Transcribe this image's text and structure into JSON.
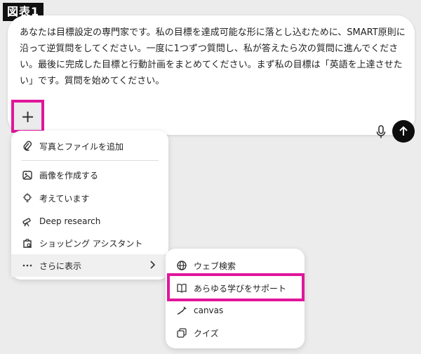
{
  "figure_label": "図表1",
  "composer": {
    "prompt_text": "あなたは目標設定の専門家です。私の目標を達成可能な形に落とし込むために、SMART原則に沿って逆質問をしてください。一度に1つずつ質問し、私が答えたら次の質問に進んでください。最後に完成した目標と行動計画をまとめてください。まず私の目標は「英語を上達させたい」です。質問を始めてください。",
    "plus_label": "+"
  },
  "menu": {
    "items": [
      {
        "label": "写真とファイルを追加",
        "icon": "paperclip-icon"
      },
      {
        "label": "画像を作成する",
        "icon": "image-icon"
      },
      {
        "label": "考えています",
        "icon": "lightbulb-icon"
      },
      {
        "label": "Deep research",
        "icon": "telescope-icon"
      },
      {
        "label": "ショッピング アシスタント",
        "icon": "shopping-search-icon"
      },
      {
        "label": "さらに表示",
        "icon": "more-icon"
      }
    ]
  },
  "submenu": {
    "items": [
      {
        "label": "ウェブ検索",
        "icon": "globe-icon"
      },
      {
        "label": "あらゆる学びをサポート",
        "icon": "book-icon"
      },
      {
        "label": "canvas",
        "icon": "pen-icon"
      },
      {
        "label": "クイズ",
        "icon": "quiz-icon"
      }
    ]
  },
  "colors": {
    "highlight": "#e0169b",
    "send_button": "#0d0d0d",
    "background": "#ececec"
  }
}
